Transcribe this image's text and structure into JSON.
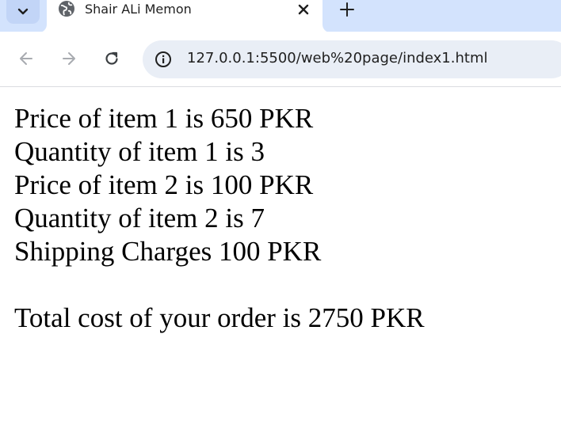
{
  "tab": {
    "title": "Shair ALi Memon",
    "favicon": "globe-icon",
    "close_icon": "close-icon"
  },
  "toolbar": {
    "url": "127.0.0.1:5500/web%20page/index1.html",
    "site_info_icon": "info-icon"
  },
  "page": {
    "lines": [
      "Price of item 1 is 650 PKR",
      "Quantity of item 1 is 3",
      "Price of item 2 is 100 PKR",
      "Quantity of item 2 is 7",
      "Shipping Charges 100 PKR"
    ],
    "total": "Total cost of your order is 2750 PKR"
  },
  "colors": {
    "tabstrip": "#d3e3fd",
    "omnibox": "#e9eef6",
    "text": "#000000"
  }
}
